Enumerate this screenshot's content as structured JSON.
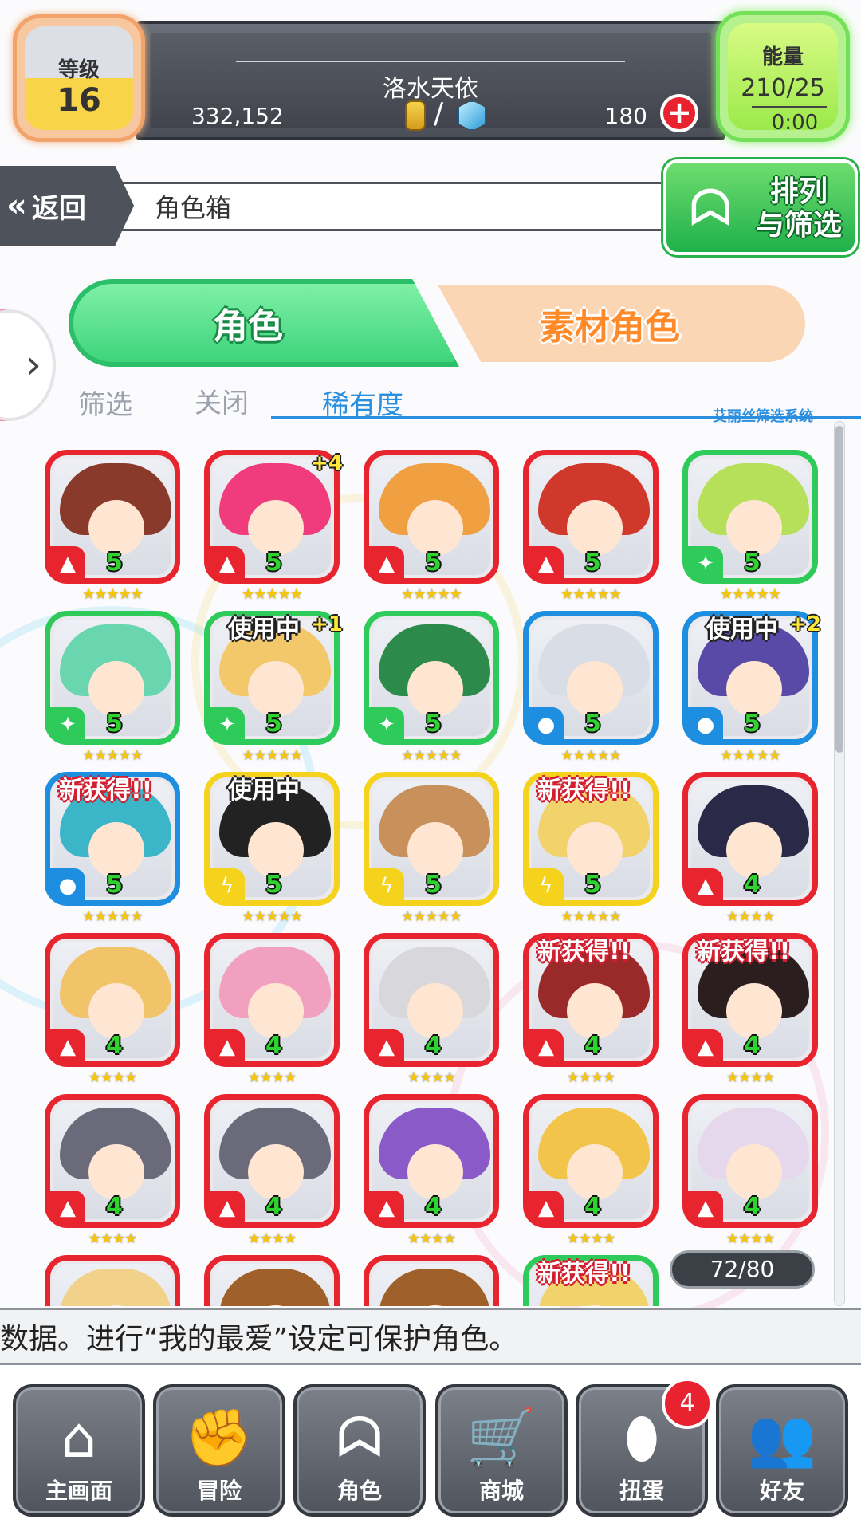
{
  "header": {
    "level_label": "等级",
    "level_value": "16",
    "player_name": "洛水天依",
    "gold": "332,152",
    "stones": "180",
    "currency_slash": "/",
    "energy_label": "能量",
    "energy_value": "210/25",
    "energy_timer": "0:00",
    "plus": "+"
  },
  "nav_bar": {
    "back_label": "返回",
    "back_arrows": "«",
    "page_title": "角色箱",
    "sort_filter_label_1": "排列",
    "sort_filter_label_2": "与筛选"
  },
  "tabs": [
    {
      "label": "角色",
      "active": true
    },
    {
      "label": "素材角色",
      "active": false
    }
  ],
  "filter": {
    "label": "筛选",
    "toggle": "关闭",
    "value": "稀有度",
    "system": "艾丽丝筛选系统"
  },
  "side_arrow": "›",
  "characters": [
    {
      "frame": "#e8242e",
      "hair": "#8a3a2a",
      "element": "fire",
      "el_glyph": "▲",
      "rarity": "5",
      "stars": "★★★★★",
      "plus": "",
      "badge": ""
    },
    {
      "frame": "#e8242e",
      "hair": "#f03c7c",
      "element": "fire",
      "el_glyph": "▲",
      "rarity": "5",
      "stars": "★★★★★",
      "plus": "+4",
      "badge": ""
    },
    {
      "frame": "#e8242e",
      "hair": "#f0a040",
      "element": "fire",
      "el_glyph": "▲",
      "rarity": "5",
      "stars": "★★★★★",
      "plus": "",
      "badge": ""
    },
    {
      "frame": "#e8242e",
      "hair": "#d0382c",
      "element": "fire",
      "el_glyph": "▲",
      "rarity": "5",
      "stars": "★★★★★",
      "plus": "",
      "badge": ""
    },
    {
      "frame": "#2fcb5a",
      "hair": "#b6e05a",
      "element": "wood",
      "el_glyph": "✦",
      "rarity": "5",
      "stars": "★★★★★",
      "plus": "",
      "badge": ""
    },
    {
      "frame": "#2fcb5a",
      "hair": "#6ad6b0",
      "element": "wood",
      "el_glyph": "✦",
      "rarity": "5",
      "stars": "★★★★★",
      "plus": "",
      "badge": ""
    },
    {
      "frame": "#2fcb5a",
      "hair": "#f2c86a",
      "element": "wood",
      "el_glyph": "✦",
      "rarity": "5",
      "stars": "★★★★★",
      "plus": "+1",
      "badge": "使用中"
    },
    {
      "frame": "#2fcb5a",
      "hair": "#2c8a4a",
      "element": "wood",
      "el_glyph": "✦",
      "rarity": "5",
      "stars": "★★★★★",
      "plus": "",
      "badge": ""
    },
    {
      "frame": "#1e8ee0",
      "hair": "#d8dde6",
      "element": "water",
      "el_glyph": "●",
      "rarity": "5",
      "stars": "★★★★★",
      "plus": "",
      "badge": ""
    },
    {
      "frame": "#1e8ee0",
      "hair": "#5a4aa8",
      "element": "water",
      "el_glyph": "●",
      "rarity": "5",
      "stars": "★★★★★",
      "plus": "+2",
      "badge": "使用中"
    },
    {
      "frame": "#1e8ee0",
      "hair": "#3ab6c8",
      "element": "water",
      "el_glyph": "●",
      "rarity": "5",
      "stars": "★★★★★",
      "plus": "",
      "badge": "新获得!!"
    },
    {
      "frame": "#f5d21c",
      "hair": "#222222",
      "element": "thunder",
      "el_glyph": "ϟ",
      "rarity": "5",
      "stars": "★★★★★",
      "plus": "",
      "badge": "使用中"
    },
    {
      "frame": "#f5d21c",
      "hair": "#c8905a",
      "element": "thunder",
      "el_glyph": "ϟ",
      "rarity": "5",
      "stars": "★★★★★",
      "plus": "",
      "badge": ""
    },
    {
      "frame": "#f5d21c",
      "hair": "#f2d26a",
      "element": "thunder",
      "el_glyph": "ϟ",
      "rarity": "5",
      "stars": "★★★★★",
      "plus": "",
      "badge": "新获得!!"
    },
    {
      "frame": "#e8242e",
      "hair": "#2a2a48",
      "element": "fire",
      "el_glyph": "▲",
      "rarity": "4",
      "stars": "★★★★",
      "plus": "",
      "badge": ""
    },
    {
      "frame": "#e8242e",
      "hair": "#f2c46a",
      "element": "fire",
      "el_glyph": "▲",
      "rarity": "4",
      "stars": "★★★★",
      "plus": "",
      "badge": ""
    },
    {
      "frame": "#e8242e",
      "hair": "#f2a0c0",
      "element": "fire",
      "el_glyph": "▲",
      "rarity": "4",
      "stars": "★★★★",
      "plus": "",
      "badge": ""
    },
    {
      "frame": "#e8242e",
      "hair": "#d8d8dc",
      "element": "fire",
      "el_glyph": "▲",
      "rarity": "4",
      "stars": "★★★★",
      "plus": "",
      "badge": ""
    },
    {
      "frame": "#e8242e",
      "hair": "#9a2a2a",
      "element": "fire",
      "el_glyph": "▲",
      "rarity": "4",
      "stars": "★★★★",
      "plus": "",
      "badge": "新获得!!"
    },
    {
      "frame": "#e8242e",
      "hair": "#2a1e1e",
      "element": "fire",
      "el_glyph": "▲",
      "rarity": "4",
      "stars": "★★★★",
      "plus": "",
      "badge": "新获得!!"
    },
    {
      "frame": "#e8242e",
      "hair": "#6a6a7a",
      "element": "fire",
      "el_glyph": "▲",
      "rarity": "4",
      "stars": "★★★★",
      "plus": "",
      "badge": ""
    },
    {
      "frame": "#e8242e",
      "hair": "#6a6a7a",
      "element": "fire",
      "el_glyph": "▲",
      "rarity": "4",
      "stars": "★★★★",
      "plus": "",
      "badge": ""
    },
    {
      "frame": "#e8242e",
      "hair": "#8a5ac8",
      "element": "fire",
      "el_glyph": "▲",
      "rarity": "4",
      "stars": "★★★★",
      "plus": "",
      "badge": ""
    },
    {
      "frame": "#e8242e",
      "hair": "#f2c44a",
      "element": "fire",
      "el_glyph": "▲",
      "rarity": "4",
      "stars": "★★★★",
      "plus": "",
      "badge": ""
    },
    {
      "frame": "#e8242e",
      "hair": "#e6d8ec",
      "element": "fire",
      "el_glyph": "▲",
      "rarity": "4",
      "stars": "★★★★",
      "plus": "",
      "badge": ""
    },
    {
      "frame": "#e8242e",
      "hair": "#f2d28a",
      "element": "fire",
      "el_glyph": "▲",
      "rarity": "",
      "stars": "",
      "plus": "",
      "badge": ""
    },
    {
      "frame": "#e8242e",
      "hair": "#a0602a",
      "element": "fire",
      "el_glyph": "▲",
      "rarity": "",
      "stars": "",
      "plus": "",
      "badge": ""
    },
    {
      "frame": "#e8242e",
      "hair": "#a0602a",
      "element": "fire",
      "el_glyph": "▲",
      "rarity": "",
      "stars": "",
      "plus": "",
      "badge": ""
    },
    {
      "frame": "#2fcb5a",
      "hair": "#f2d26a",
      "element": "wood",
      "el_glyph": "✦",
      "rarity": "",
      "stars": "",
      "plus": "",
      "badge": "新获得!!"
    }
  ],
  "box_count": "72/80",
  "ticker_text": "数据。进行“我的最爱”设定可保护角色。",
  "bottom_nav": [
    {
      "label": "主画面",
      "icon": "home-icon",
      "glyph": "⌂"
    },
    {
      "label": "冒险",
      "icon": "handshake-icon",
      "glyph": "✊"
    },
    {
      "label": "角色",
      "icon": "bunny-icon",
      "glyph": "ᗣ"
    },
    {
      "label": "商城",
      "icon": "cart-icon",
      "glyph": "🛒"
    },
    {
      "label": "扭蛋",
      "icon": "egg-icon",
      "glyph": "⬮"
    },
    {
      "label": "好友",
      "icon": "friends-icon",
      "glyph": "👥"
    }
  ],
  "gacha_notification": "4"
}
